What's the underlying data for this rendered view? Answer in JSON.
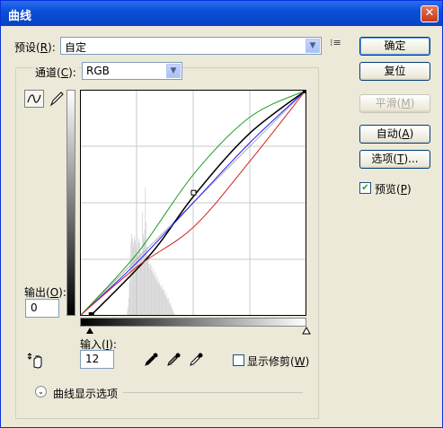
{
  "dialog": {
    "title": "曲线",
    "close_glyph": "✕"
  },
  "preset": {
    "label": "预设(R):",
    "value": "自定",
    "menu_glyph": "⁝≡"
  },
  "channel": {
    "label": "通道(C):",
    "value": "RGB"
  },
  "buttons": {
    "ok": "确定",
    "reset": "复位",
    "smooth": "平滑(M)",
    "auto": "自动(A)",
    "options": "选项(T)..."
  },
  "preview": {
    "label": "预览(P)",
    "checked": true
  },
  "output": {
    "label": "输出(O):",
    "value": "0"
  },
  "input": {
    "label": "输入(I):",
    "value": "12"
  },
  "clipping": {
    "label": "显示修剪(W)",
    "checked": false
  },
  "curve_display_options": {
    "label": "曲线显示选项"
  },
  "chart_data": {
    "type": "line",
    "xlim": [
      0,
      255
    ],
    "ylim": [
      0,
      255
    ],
    "grid": true,
    "series": [
      {
        "color": "#000000",
        "points": [
          [
            12,
            0
          ],
          [
            80,
            70
          ],
          [
            128,
            135
          ],
          [
            190,
            205
          ],
          [
            255,
            255
          ]
        ]
      },
      {
        "color": "#1a1aff",
        "points": [
          [
            0,
            0
          ],
          [
            64,
            60
          ],
          [
            128,
            128
          ],
          [
            192,
            196
          ],
          [
            255,
            255
          ]
        ]
      },
      {
        "color": "#1e9e1e",
        "points": [
          [
            0,
            0
          ],
          [
            64,
            70
          ],
          [
            128,
            160
          ],
          [
            192,
            225
          ],
          [
            255,
            255
          ]
        ]
      },
      {
        "color": "#d42020",
        "points": [
          [
            0,
            0
          ],
          [
            64,
            55
          ],
          [
            128,
            100
          ],
          [
            192,
            175
          ],
          [
            255,
            255
          ]
        ]
      }
    ],
    "control_points": [
      [
        12,
        0
      ],
      [
        128,
        139
      ],
      [
        255,
        255
      ]
    ],
    "histogram": [
      0,
      0,
      0,
      0,
      0,
      0,
      0,
      0,
      0,
      0,
      0,
      0,
      0,
      0,
      0,
      0,
      0,
      0,
      0,
      0,
      0,
      0,
      0,
      0,
      0,
      0,
      0,
      0,
      0,
      0,
      0,
      0,
      0,
      0,
      0,
      0,
      0,
      0,
      0,
      0,
      0,
      0,
      0,
      0,
      0,
      0,
      0,
      0,
      0,
      0,
      0,
      0,
      0,
      0,
      0,
      0,
      0,
      0,
      0,
      0,
      0,
      0,
      0,
      0,
      5,
      10,
      20,
      40,
      65,
      85,
      95,
      90,
      80,
      85,
      92,
      88,
      80,
      75,
      70,
      85,
      90,
      85,
      78,
      72,
      70,
      120,
      95,
      90,
      100,
      150,
      110,
      80,
      70,
      65,
      60,
      55,
      60,
      58,
      52,
      50,
      55,
      48,
      45,
      50,
      42,
      40,
      45,
      38,
      36,
      40,
      34,
      32,
      35,
      30,
      28,
      30,
      25,
      22,
      26,
      20,
      18,
      20,
      15,
      12,
      14,
      10,
      8,
      6,
      4,
      2,
      0,
      0,
      0,
      0,
      0,
      0,
      0,
      0,
      0,
      0,
      0,
      0,
      0,
      0,
      0,
      0,
      0,
      0,
      0,
      0,
      0,
      0,
      0,
      0,
      0,
      0,
      0,
      0,
      0,
      0,
      0,
      0,
      0,
      0,
      0,
      0,
      0,
      0,
      0,
      0,
      0,
      0,
      0,
      0,
      0,
      0,
      0,
      0,
      0,
      0,
      0,
      0,
      0,
      0,
      0,
      0,
      0,
      0,
      0,
      0,
      0,
      0,
      0,
      0,
      0,
      0,
      0,
      0,
      0,
      0,
      0,
      0,
      0,
      0,
      0,
      0,
      0,
      0,
      0,
      0,
      0,
      0,
      0,
      0,
      0,
      0,
      0,
      0,
      0,
      0,
      0,
      0,
      0,
      0,
      0,
      0,
      0,
      0,
      0,
      0,
      0,
      0,
      0,
      0,
      0,
      0,
      0,
      0,
      0,
      0,
      0,
      0,
      0,
      0,
      0,
      0,
      0,
      0,
      0,
      0,
      0,
      0,
      0,
      0,
      0,
      0,
      0,
      0,
      0,
      0,
      0,
      0,
      0,
      0,
      0,
      0,
      0,
      0,
      0,
      0,
      0,
      0,
      0,
      0,
      0,
      0,
      0,
      0,
      0,
      0,
      0,
      0,
      0,
      0,
      0,
      0,
      0,
      0,
      0,
      0,
      0,
      0,
      0,
      0,
      0,
      0,
      0,
      0,
      0,
      0,
      0,
      0,
      0,
      0,
      0,
      0,
      0,
      0,
      0,
      0,
      0,
      0
    ]
  }
}
